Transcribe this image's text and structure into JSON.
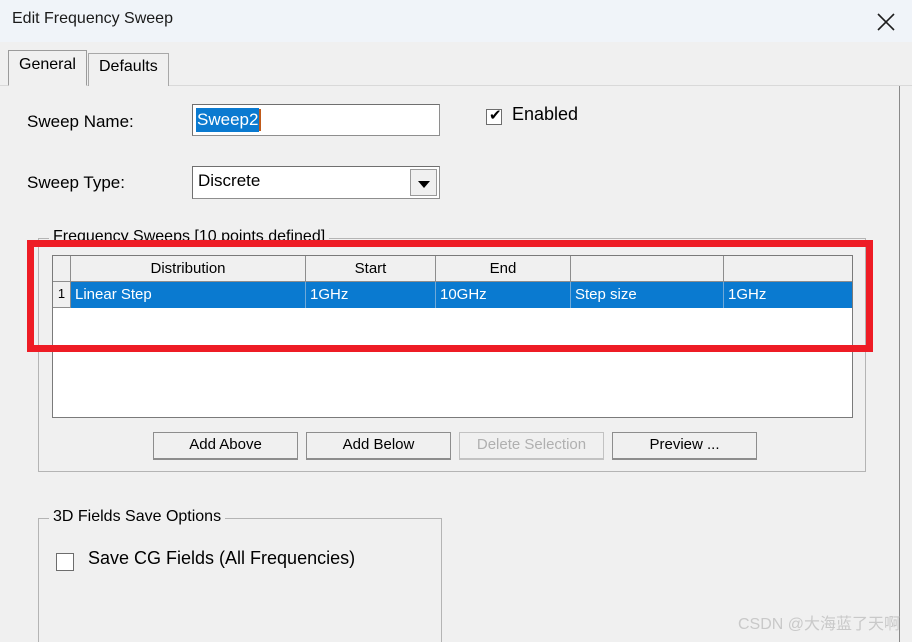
{
  "window": {
    "title": "Edit Frequency Sweep",
    "close_icon": "close-icon"
  },
  "tabs": [
    {
      "label": "General",
      "selected": true
    },
    {
      "label": "Defaults",
      "selected": false
    }
  ],
  "form": {
    "sweep_name_label": "Sweep Name:",
    "sweep_name_value": "Sweep2",
    "sweep_type_label": "Sweep Type:",
    "sweep_type_value": "Discrete",
    "dropdown_icon": "chevron-down-icon",
    "enabled_label": "Enabled",
    "enabled_checked": true,
    "enabled_check_glyph": "✔"
  },
  "sweeps_group": {
    "title": "Frequency Sweeps [10 points defined]",
    "table": {
      "headers": [
        "",
        "Distribution",
        "Start",
        "End",
        "",
        ""
      ],
      "rows": [
        {
          "index": "1",
          "selected": true,
          "cells": [
            "Linear Step",
            "1GHz",
            "10GHz",
            "Step size",
            "1GHz"
          ]
        }
      ]
    },
    "buttons": [
      {
        "label": "Add Above",
        "enabled": true
      },
      {
        "label": "Add Below",
        "enabled": true
      },
      {
        "label": "Delete Selection",
        "enabled": false
      },
      {
        "label": "Preview ...",
        "enabled": true
      }
    ]
  },
  "fields_group": {
    "title": "3D Fields Save Options",
    "save_cg_label": "Save CG Fields (All Frequencies)",
    "save_cg_checked": false
  },
  "annotation": {
    "highlight_color": "#ee1c25"
  },
  "watermark": {
    "text": "CSDN @大海蓝了天啊"
  }
}
